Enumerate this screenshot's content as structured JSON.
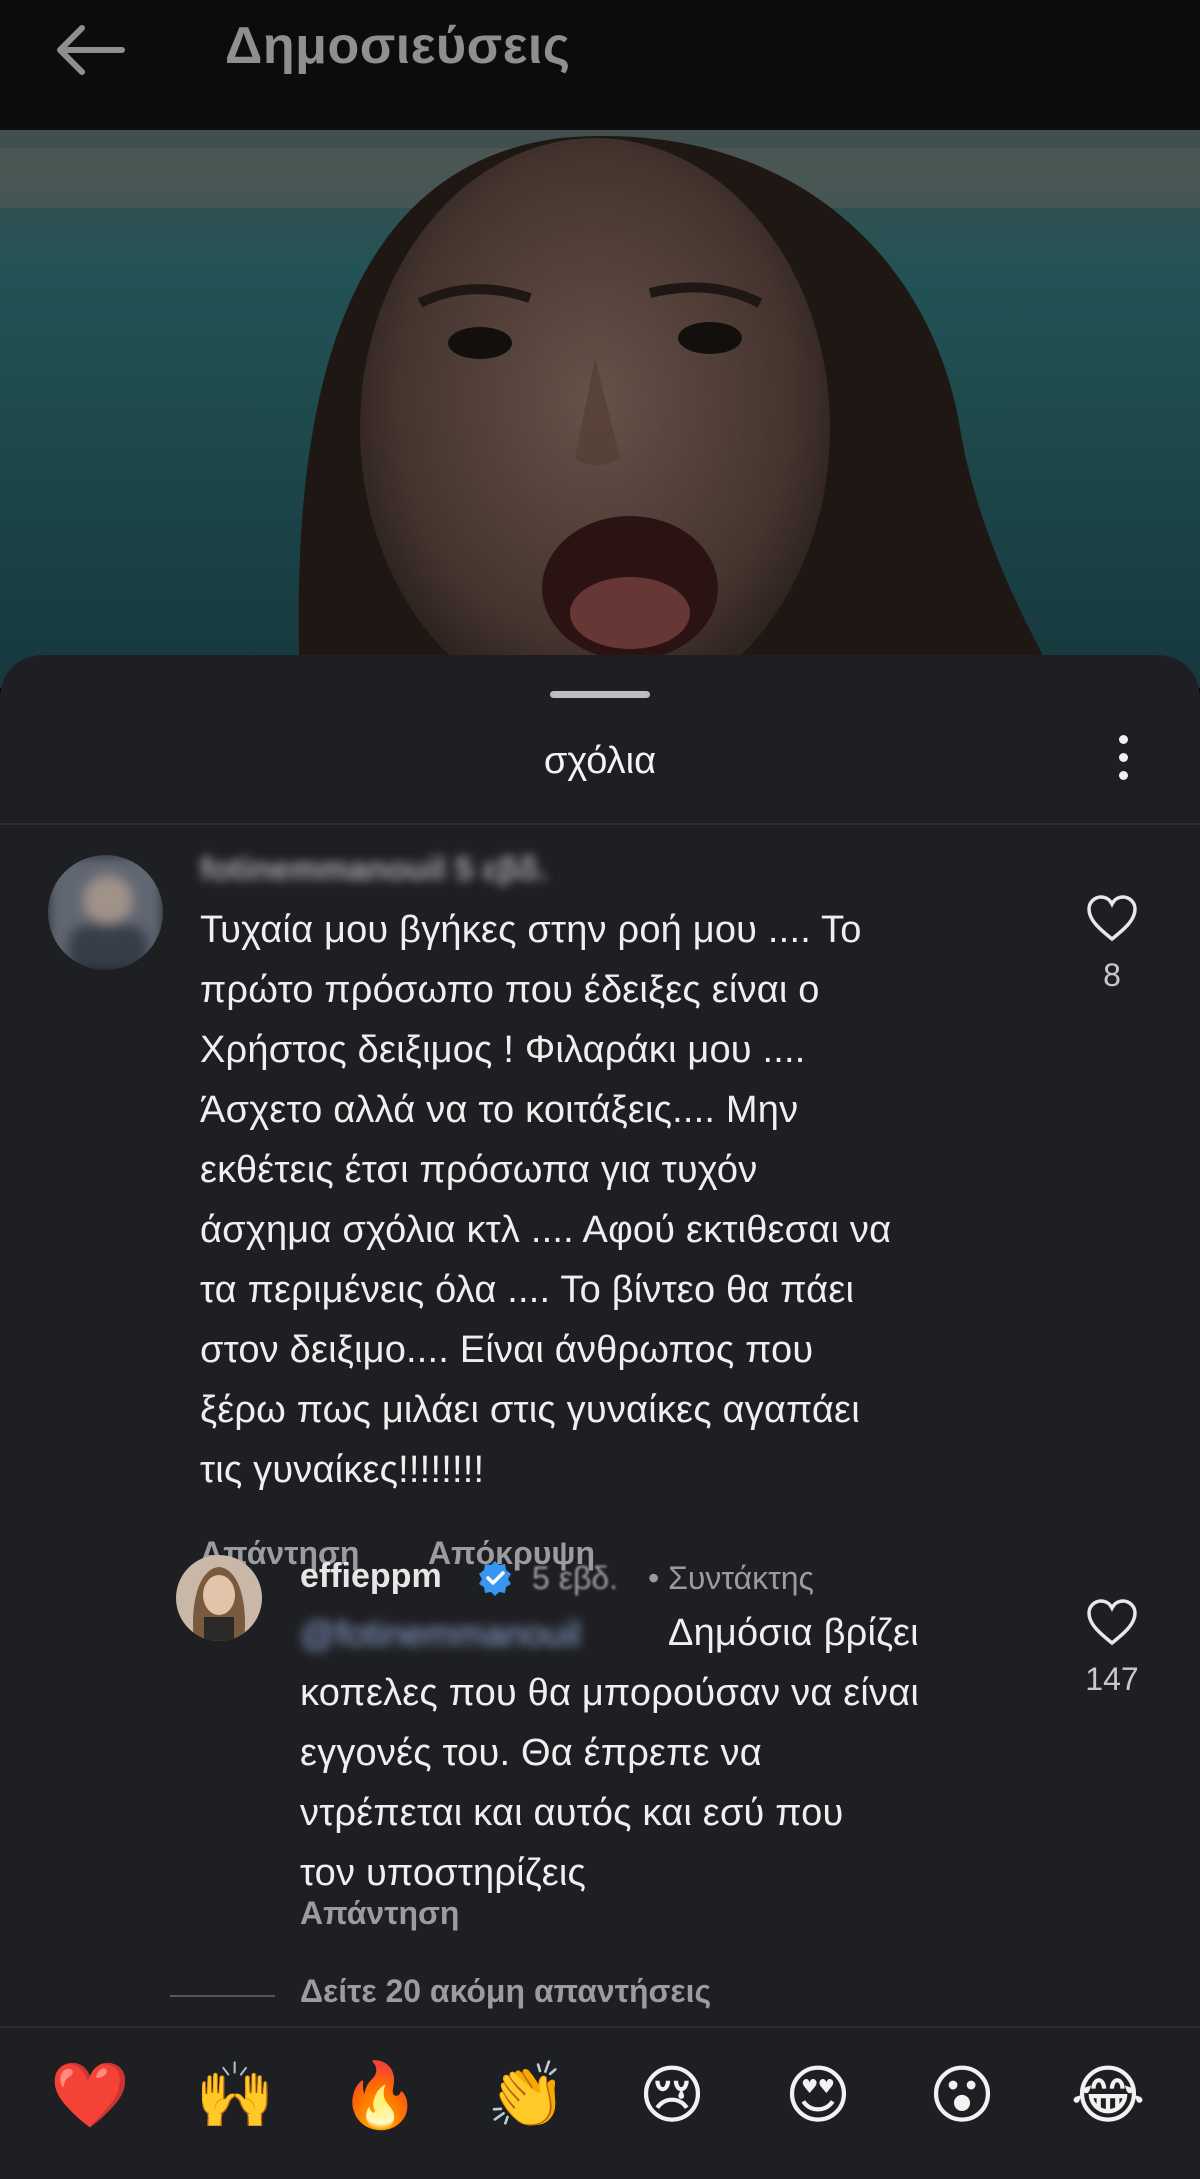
{
  "header": {
    "title": "Δημοσιεύσεις",
    "back_icon": "arrow-left-icon"
  },
  "sheet": {
    "title": "σχόλια",
    "menu_icon": "more-vertical-icon"
  },
  "comment": {
    "username": "fotinemmanouil 5 εβδ.",
    "text_lines": [
      "Τυχαία μου βγήκες στην ροή μου .... Το",
      "πρώτο πρόσωπο που έδειξες είναι ο",
      "Χρήστος δειξιμος ! Φιλαράκι μου ....",
      "Άσχετο αλλά να το κοιτάξεις.... Μην",
      "εκθέτεις έτσι πρόσωπα για τυχόν",
      "άσχημα σχόλια κτλ .... Αφού εκτιθεσαι να",
      "τα περιμένεις όλα .... Το βίντεο θα πάει",
      "στον δειξιμο.... Είναι άνθρωπος που",
      "ξέρω πως μιλάει στις γυναίκες αγαπάει",
      "τις γυναίκες!!!!!!!!"
    ],
    "reply_label": "Απάντηση",
    "hide_label": "Απόκρυψη",
    "likes": "8"
  },
  "reply": {
    "username": "effieppm",
    "time": "5 εβδ.",
    "role": "• Συντάκτης",
    "mention": "@fotinemmanouil",
    "text_lines": [
      "Δημόσια βρίζει",
      "κοπελες που θα μπορούσαν να είναι",
      "εγγονές του. Θα έπρεπε να",
      "ντρέπεται και αυτός και εσύ που",
      "τον υποστηρίζεις"
    ],
    "reply_label": "Απάντηση",
    "likes": "147"
  },
  "view_more": "Δείτε 20 ακόμη απαντήσεις",
  "emoji_bar": [
    "❤️",
    "🙌",
    "🔥",
    "👏",
    "😢",
    "😍",
    "😮",
    "😂"
  ],
  "colors": {
    "sheet_bg": "#1e1f22",
    "verified": "#3797f0",
    "muted_text": "#9b9c9f"
  }
}
